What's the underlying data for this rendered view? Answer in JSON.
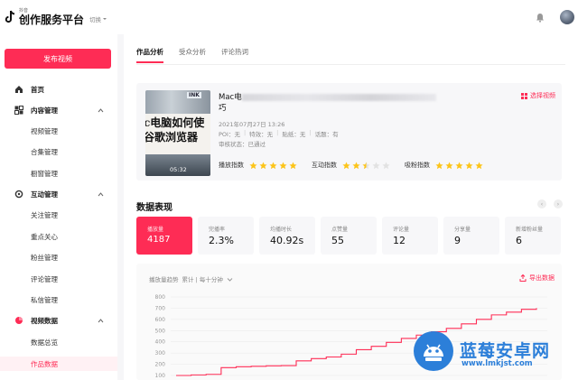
{
  "header": {
    "brand_small": "抖音",
    "brand_title": "创作服务平台",
    "switch_label": "切换",
    "icons": {
      "logo": "douyin-logo-icon",
      "bell": "bell-icon",
      "avatar": "avatar"
    }
  },
  "sidebar": {
    "publish_label": "发布视频",
    "items": [
      {
        "label": "首页",
        "icon": "home-icon"
      },
      {
        "label": "内容管理",
        "icon": "content-icon"
      },
      {
        "label": "视频管理"
      },
      {
        "label": "合集管理"
      },
      {
        "label": "橱窗管理"
      },
      {
        "label": "互动管理",
        "icon": "interaction-icon"
      },
      {
        "label": "关注管理"
      },
      {
        "label": "重点关心"
      },
      {
        "label": "粉丝管理"
      },
      {
        "label": "评论管理"
      },
      {
        "label": "私信管理"
      },
      {
        "label": "视频数据",
        "icon": "data-pie-icon"
      },
      {
        "label": "数据总览"
      },
      {
        "label": "作品数据"
      }
    ]
  },
  "main": {
    "tabs": [
      {
        "label": "作品分析",
        "active": true
      },
      {
        "label": "受众分析",
        "active": false
      },
      {
        "label": "评论热词",
        "active": false
      }
    ],
    "video": {
      "title_start": "Mac电",
      "title_end": "巧",
      "date": "2021年07月27日 13:26",
      "meta": [
        "POI：无",
        "特效：无",
        "贴纸：无",
        "话题：有"
      ],
      "status": "审核状态：已通过",
      "duration": "05:32",
      "thumb_lines": [
        "c电脑如何使",
        "谷歌浏览器"
      ],
      "thumb_label": "INK",
      "pick_label": "选择视频",
      "ratings": [
        {
          "label": "播放指数",
          "stars": 5
        },
        {
          "label": "互动指数",
          "stars": 2.5
        },
        {
          "label": "吸粉指数",
          "stars": 5
        }
      ],
      "star_color": "#fcc419"
    },
    "section_title": "数据表现",
    "metrics": [
      {
        "label": "播放量",
        "value": "4187"
      },
      {
        "label": "完播率",
        "value": "2.3%"
      },
      {
        "label": "均播时长",
        "value": "40.92s"
      },
      {
        "label": "点赞量",
        "value": "55"
      },
      {
        "label": "评论量",
        "value": "12"
      },
      {
        "label": "分享量",
        "value": "9"
      },
      {
        "label": "新增粉丝量",
        "value": "6"
      }
    ],
    "chart_head": "播放量趋势",
    "chart_mode": "累计 | 每十分钟",
    "export_label": "导出数据",
    "accent": "#fe2c55"
  },
  "chart_data": {
    "type": "line",
    "yticks": [
      "800",
      "700",
      "600",
      "500",
      "400",
      "300",
      "200",
      "100"
    ],
    "ylim": [
      100,
      800
    ],
    "series": [
      {
        "values": [
          100,
          105,
          110,
          170,
          178,
          182,
          186,
          188,
          230,
          250,
          265,
          290,
          330,
          360,
          395,
          430,
          460,
          490,
          520,
          560,
          600,
          640,
          665,
          690,
          700
        ]
      }
    ]
  },
  "watermark": {
    "name": "蓝莓安卓网",
    "url": "www.lmkjst.com"
  }
}
